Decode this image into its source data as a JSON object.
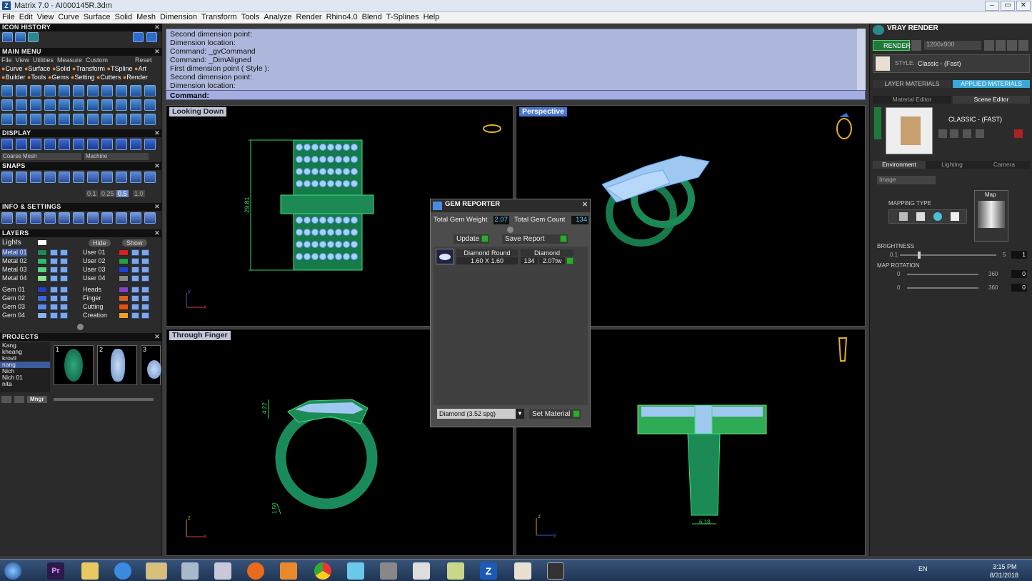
{
  "window": {
    "title": "Matrix 7.0 - AI000145R.3dm",
    "logo": "Z"
  },
  "menu": [
    "File",
    "Edit",
    "View",
    "Curve",
    "Surface",
    "Solid",
    "Mesh",
    "Dimension",
    "Transform",
    "Tools",
    "Analyze",
    "Render",
    "Rhino4.0",
    "Blend",
    "T-Splines",
    "Help"
  ],
  "left": {
    "icon_history": "ICON HISTORY",
    "main_menu": "MAIN MENU",
    "submenu": [
      "File",
      "View",
      "Utilities",
      "Measure",
      "Custom"
    ],
    "reset": "Reset",
    "cat_row1": [
      "Curve",
      "Surface",
      "Solid",
      "Transform",
      "TSpline",
      "Art"
    ],
    "cat_row2": [
      "Builder",
      "Tools",
      "Gems",
      "Setting",
      "Cutters",
      "Render"
    ],
    "display": "DISPLAY",
    "display_mesh": "Coarse Mesh",
    "display_mode": "Machine",
    "snaps": "SNAPS",
    "snap_values": [
      "0.1",
      "0.25",
      "0.5",
      "1.0"
    ],
    "info": "INFO & SETTINGS",
    "layers": "LAYERS",
    "lights": "Lights",
    "hide": "Hide",
    "show": "Show",
    "layers_left": [
      "Metal 01",
      "Metal 02",
      "Metal 03",
      "Metal 04",
      "Gem 01",
      "Gem 02",
      "Gem 03",
      "Gem 04"
    ],
    "layers_right": [
      "User 01",
      "User 02",
      "User 03",
      "User 04",
      "Heads",
      "Finger",
      "Cutting",
      "Creation"
    ],
    "projects": "PROJECTS",
    "project_names": [
      "Kang",
      "kheang",
      "krovil",
      "nang",
      "Nich",
      "Nich 01",
      "nita"
    ],
    "project_nums": [
      "1",
      "2",
      "3"
    ],
    "mngr": "Mngr"
  },
  "command": {
    "lines": [
      "Second dimension point:",
      "Dimension location:",
      "Command: _gvCommand",
      "Command: _DimAligned",
      "First dimension point ( Style ):",
      "Second dimension point:",
      "Dimension location:"
    ],
    "prompt": "Command:"
  },
  "viewports": {
    "top_left": "Looking Down",
    "top_right": "Perspective",
    "bottom_left": "Through Finger",
    "dim_top": "29.81",
    "dim_front1": "4.22",
    "dim_front2": "1.50",
    "dim_right": "6.18",
    "axis_y": "y",
    "axis_x": "x",
    "axis_z": "z"
  },
  "gem_reporter": {
    "title": "GEM REPORTER",
    "weight_label": "Total Gem Weight",
    "weight_value": "2.07",
    "count_label": "Total Gem Count",
    "count_value": "134",
    "update": "Update",
    "save": "Save Report",
    "col1": "Diamond Round",
    "col2": "Diamond",
    "size": "1.60 X 1.60",
    "qty": "134",
    "tw": "2.07tw",
    "material": "Diamond    (3.52 spg)",
    "set_material": "Set Material"
  },
  "right": {
    "title": "VRAY RENDER",
    "render": "RENDER",
    "resolution": "1200x900",
    "style_label": "STYLE:",
    "style_value": "Classic - (Fast)",
    "tab_layer": "LAYER MATERIALS",
    "tab_applied": "APPLIED MATERIALS",
    "tab_mat_editor": "Material Editor",
    "tab_scene": "Scene Editor",
    "scene_name": "CLASSIC - (FAST)",
    "tab_env": "Environment",
    "tab_light": "Lighting",
    "tab_cam": "Camera",
    "env_type": "Image",
    "mapping": "MAPPING TYPE",
    "map": "Map",
    "brightness": "BRIGHTNESS",
    "b_min": "0.1",
    "b_max": "5",
    "b_val": "1",
    "map_rotation": "MAP ROTATION",
    "r_min": "0",
    "r_max": "360",
    "r_val": "0"
  },
  "taskbar": {
    "lang": "EN",
    "time": "3:15 PM",
    "date": "8/31/2018"
  }
}
